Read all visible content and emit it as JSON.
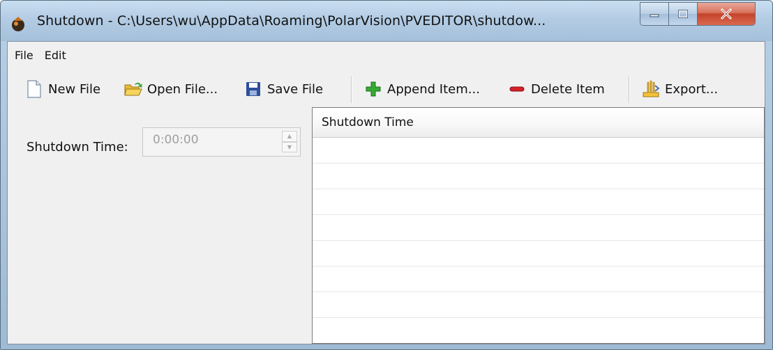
{
  "window": {
    "title": "Shutdown - C:\\Users\\wu\\AppData\\Roaming\\PolarVision\\PVEDITOR\\shutdow...",
    "icon": "app-bomb-icon",
    "controls": [
      "minimize-icon",
      "maximize-icon",
      "close-icon"
    ]
  },
  "menubar": {
    "file": {
      "label": "File"
    },
    "edit": {
      "label": "Edit"
    }
  },
  "toolbar": {
    "new_file": {
      "label": "New File",
      "icon": "new-file-icon"
    },
    "open_file": {
      "label": "Open File...",
      "icon": "open-folder-icon"
    },
    "save_file": {
      "label": "Save File",
      "icon": "save-disk-icon"
    },
    "append_item": {
      "label": "Append Item...",
      "icon": "plus-icon",
      "color": "#2fa52f"
    },
    "delete_item": {
      "label": "Delete Item",
      "icon": "minus-icon",
      "color": "#d0202a"
    },
    "export": {
      "label": "Export...",
      "icon": "export-icon"
    }
  },
  "form": {
    "shutdown_time_label": "Shutdown Time:",
    "shutdown_time_value": "0:00:00"
  },
  "table": {
    "columns": [
      "Shutdown Time"
    ],
    "rows": []
  }
}
